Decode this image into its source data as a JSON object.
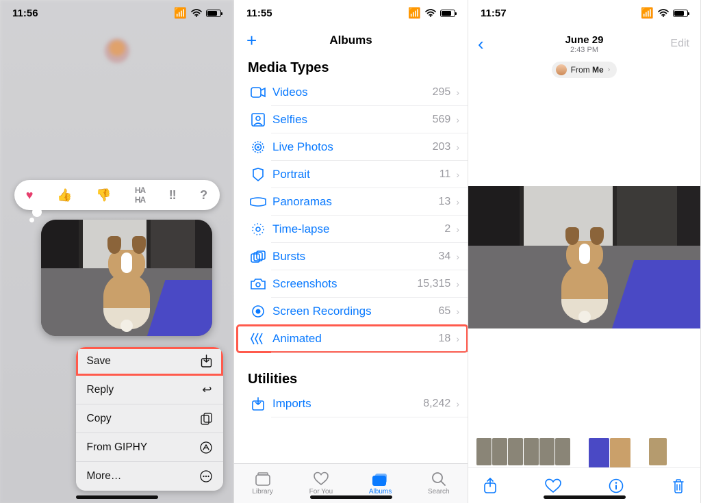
{
  "pane1": {
    "time": "11:56",
    "reactions": [
      "heart",
      "thumbs-up",
      "thumbs-down",
      "haha",
      "exclaim",
      "question"
    ],
    "actions": [
      {
        "label": "Save",
        "icon": "download-icon",
        "highlight": true
      },
      {
        "label": "Reply",
        "icon": "reply-icon"
      },
      {
        "label": "Copy",
        "icon": "copy-icon"
      },
      {
        "label": "From GIPHY",
        "icon": "appstore-icon"
      },
      {
        "label": "More…",
        "icon": "ellipsis-icon"
      }
    ]
  },
  "pane2": {
    "time": "11:55",
    "title": "Albums",
    "section1": "Media Types",
    "rows": [
      {
        "icon": "video-icon",
        "label": "Videos",
        "count": "295"
      },
      {
        "icon": "selfie-icon",
        "label": "Selfies",
        "count": "569"
      },
      {
        "icon": "livephoto-icon",
        "label": "Live Photos",
        "count": "203"
      },
      {
        "icon": "portrait-icon",
        "label": "Portrait",
        "count": "11"
      },
      {
        "icon": "panorama-icon",
        "label": "Panoramas",
        "count": "13"
      },
      {
        "icon": "timelapse-icon",
        "label": "Time-lapse",
        "count": "2"
      },
      {
        "icon": "burst-icon",
        "label": "Bursts",
        "count": "34"
      },
      {
        "icon": "screenshot-icon",
        "label": "Screenshots",
        "count": "15,315"
      },
      {
        "icon": "screenrec-icon",
        "label": "Screen Recordings",
        "count": "65"
      },
      {
        "icon": "animated-icon",
        "label": "Animated",
        "count": "18",
        "highlight": true
      }
    ],
    "section2": "Utilities",
    "rows2": [
      {
        "icon": "imports-icon",
        "label": "Imports",
        "count": "8,242"
      }
    ],
    "tabs": [
      {
        "icon": "library-icon",
        "label": "Library"
      },
      {
        "icon": "foryou-icon",
        "label": "For You"
      },
      {
        "icon": "albums-icon",
        "label": "Albums",
        "active": true
      },
      {
        "icon": "search-icon",
        "label": "Search"
      }
    ]
  },
  "pane3": {
    "time": "11:57",
    "date": "June 29",
    "subtime": "2:43 PM",
    "edit": "Edit",
    "pill_prefix": "From ",
    "pill_bold": "Me",
    "toolbar": [
      "share-icon",
      "heart-outline-icon",
      "info-icon",
      "trash-icon"
    ]
  }
}
